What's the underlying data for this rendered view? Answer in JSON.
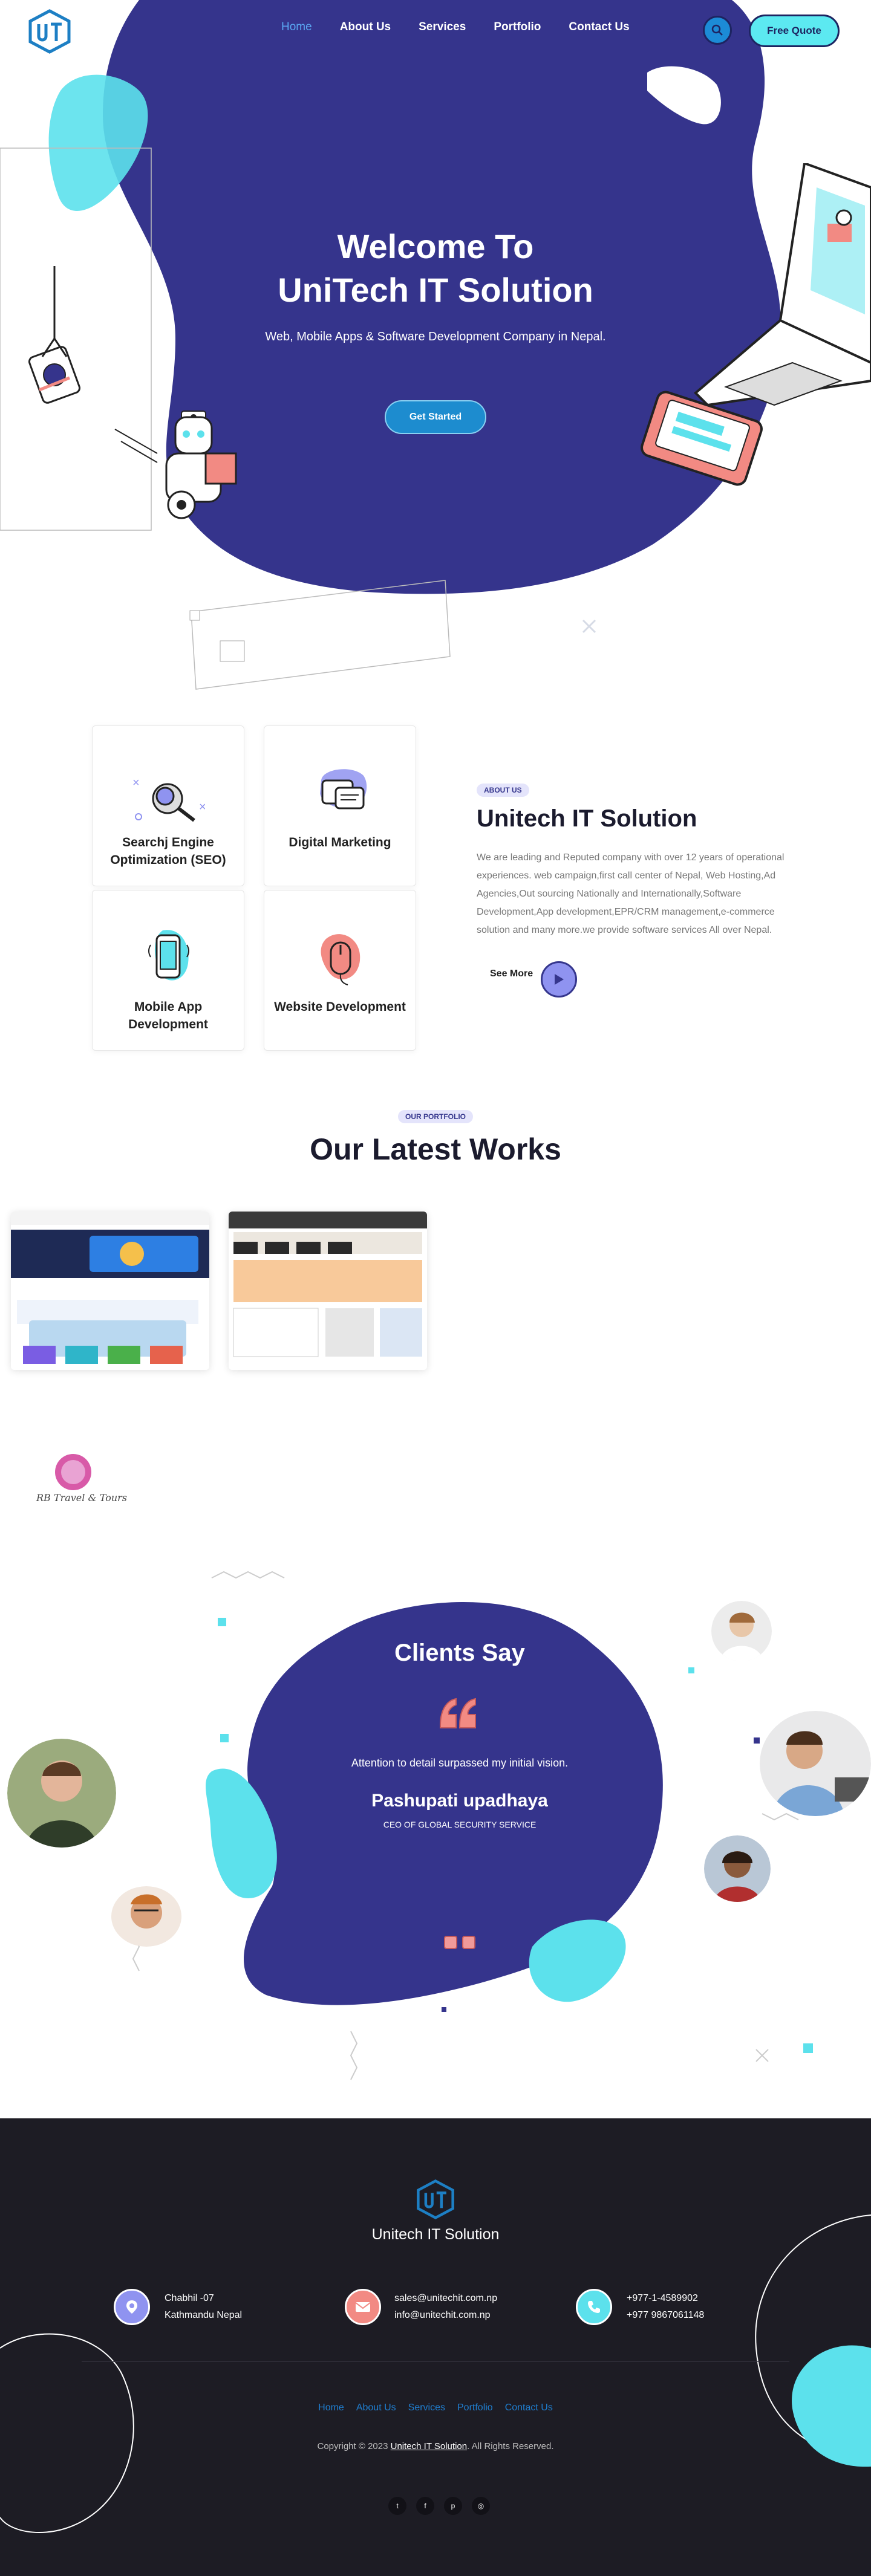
{
  "header": {
    "nav": [
      "Home",
      "About Us",
      "Services",
      "Portfolio",
      "Contact Us"
    ],
    "active_nav": "Home",
    "quote_label": "Free Quote"
  },
  "hero": {
    "title_line1": "Welcome To",
    "title_line2": "UniTech IT Solution",
    "subtitle": "Web, Mobile Apps & Software Development Company in Nepal.",
    "cta_label": "Get Started"
  },
  "services": [
    {
      "label": "Searchj Engine Optimization (SEO)",
      "icon": "magnifier-icon"
    },
    {
      "label": "Digital Marketing",
      "icon": "chat-bubbles-icon"
    },
    {
      "label": "Mobile App Development",
      "icon": "mobile-phone-icon"
    },
    {
      "label": "Website Development",
      "icon": "mouse-icon"
    }
  ],
  "about": {
    "badge": "ABOUT US",
    "title": "Unitech IT Solution",
    "text": "We are leading and Reputed company with over 12 years of operational experiences. web campaign,first call center of Nepal, Web Hosting,Ad Agencies,Out sourcing Nationally and Internationally,Software Development,App development,EPR/CRM management,e-commerce solution and many more.we provide software services All over Nepal.",
    "see_more": "See More"
  },
  "portfolio": {
    "badge": "OUR PORTFOLIO",
    "title": "Our Latest Works"
  },
  "partner": {
    "name": "RB Travel & Tours"
  },
  "testimonial": {
    "title": "Clients Say",
    "quote": "Attention to detail surpassed my initial vision.",
    "name": "Pashupati upadhaya",
    "role": "CEO OF GLOBAL SECURITY SERVICE"
  },
  "footer": {
    "brand": "Unitech IT Solution",
    "address_line1": "Chabhil -07",
    "address_line2": "Kathmandu Nepal",
    "email_line1": "sales@unitechit.com.np",
    "email_line2": "info@unitechit.com.np",
    "phone_line1": "+977-1-4589902",
    "phone_line2": "+977 9867061148",
    "links": [
      "Home",
      "About Us",
      "Services",
      "Portfolio",
      "Contact Us"
    ],
    "copyright_prefix": "Copyright © 2023",
    "copyright_link": "Unitech IT Solution",
    "copyright_suffix": ". All Rights Reserved.",
    "social": [
      "twitter-icon",
      "facebook-icon",
      "pinterest-icon",
      "instagram-icon"
    ]
  },
  "colors": {
    "brand_blue": "#35348c",
    "cyan": "#5ce1ec",
    "coral": "#f28a83",
    "footer_bg": "#1d1c24",
    "link_blue": "#1f7fd1"
  }
}
